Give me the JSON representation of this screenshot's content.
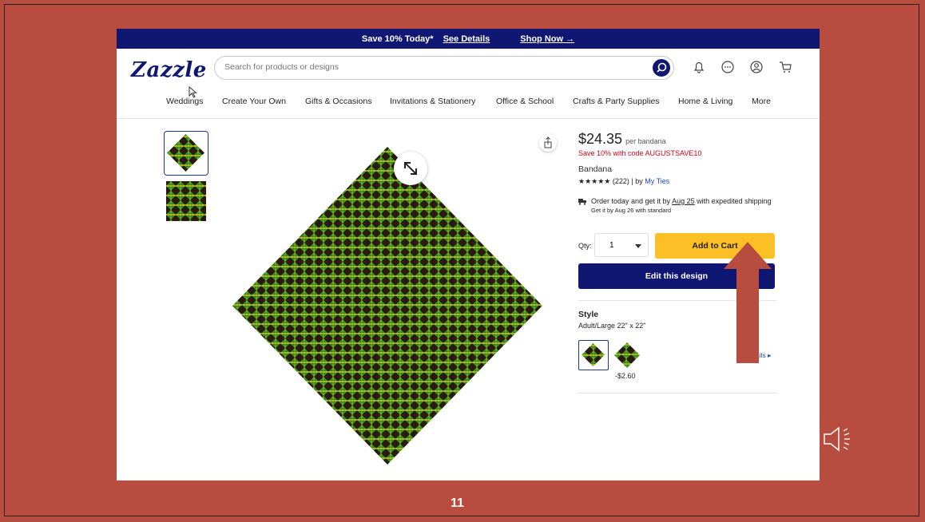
{
  "promo_bar": {
    "text": "Save 10% Today*",
    "details_link": "See Details",
    "shop_link": "Shop Now →"
  },
  "header": {
    "logo": "Zazzle",
    "search_placeholder": "Search for products or designs",
    "icons": [
      "search-icon",
      "bell-icon",
      "chat-icon",
      "account-icon",
      "cart-icon"
    ]
  },
  "nav": {
    "items": [
      "Weddings",
      "Create Your Own",
      "Gifts & Occasions",
      "Invitations & Stationery",
      "Office & School",
      "Crafts & Party Supplies",
      "Home & Living",
      "More"
    ]
  },
  "product": {
    "price": "$24.35",
    "price_unit": "per bandana",
    "promo": "Save 10% with code AUGUSTSAVE10",
    "name": "Bandana",
    "rating_stars": "★★★★★",
    "rating_count": "(222)",
    "by_prefix": "| by",
    "seller": "My Ties",
    "shipping": {
      "pre": "Order today and get it by",
      "date": "Aug 25",
      "post": "with expedited shipping",
      "standard": "Get it by Aug 26 with standard"
    },
    "qty_label": "Qty:",
    "qty_value": "1",
    "add_to_cart": "Add to Cart",
    "edit_design": "Edit this design",
    "style_label": "Style",
    "style_value": "Adult/Large 22\" x 22\"",
    "option_price": "-$2.60",
    "details_link": "ails ▸"
  },
  "colors": {
    "brand_navy": "#0f1773",
    "add_to_cart": "#fcbf26",
    "slide_bg": "#b84d3f",
    "promo_red": "#d0021b",
    "arrow": "#b84d3f"
  },
  "slide": {
    "number": "11"
  }
}
